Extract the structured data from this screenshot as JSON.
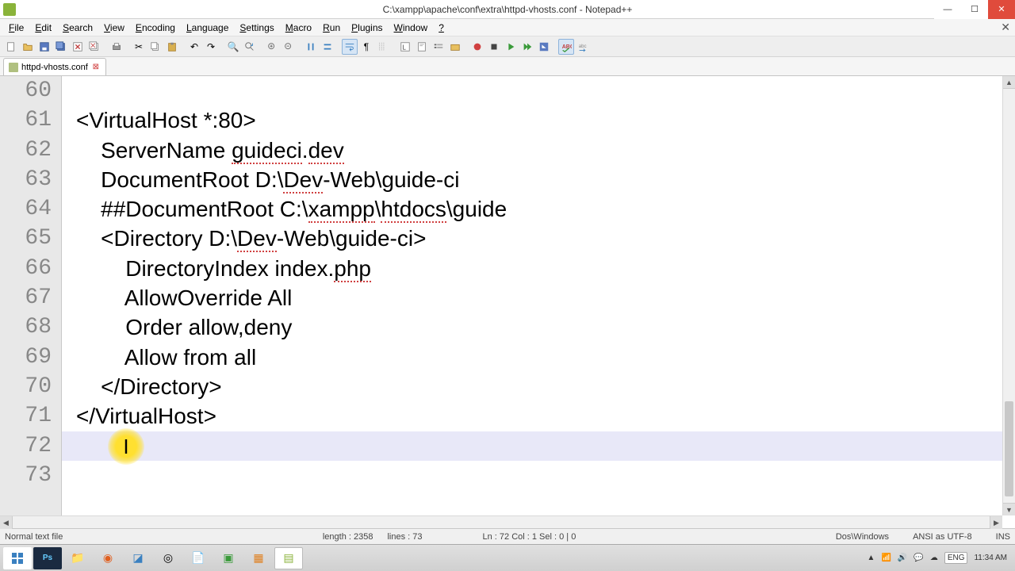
{
  "title": "C:\\xampp\\apache\\conf\\extra\\httpd-vhosts.conf - Notepad++",
  "menus": [
    "File",
    "Edit",
    "Search",
    "View",
    "Encoding",
    "Language",
    "Settings",
    "Macro",
    "Run",
    "Plugins",
    "Window",
    "?"
  ],
  "tab": {
    "label": "httpd-vhosts.conf"
  },
  "gutter_start": 60,
  "lines": [
    "",
    "<VirtualHost *:80>",
    "    ServerName guideci.dev",
    "    DocumentRoot D:\\Dev-Web\\guide-ci",
    "    ##DocumentRoot C:\\xampp\\htdocs\\guide",
    "    <Directory D:\\Dev-Web\\guide-ci>",
    "        DirectoryIndex index.php",
    "        AllowOverride All",
    "        Order allow,deny",
    "        Allow from all",
    "    </Directory>",
    "</VirtualHost>",
    "",
    ""
  ],
  "current_line_index": 12,
  "underline_spans": {
    "2": [
      [
        "guideci",
        0
      ],
      [
        "dev",
        0
      ]
    ],
    "3": [
      [
        "Dev",
        0
      ],
      [
        "ci",
        1
      ]
    ],
    "4": [
      [
        "xampp",
        0
      ],
      [
        "htdocs",
        0
      ]
    ],
    "5": [
      [
        "Dev",
        0
      ],
      [
        "ci",
        1
      ]
    ],
    "6": [
      [
        "php",
        0
      ]
    ]
  },
  "status": {
    "left": "Normal text file",
    "length": "length : 2358",
    "lines": "lines : 73",
    "pos": "Ln : 72    Col : 1    Sel : 0 | 0",
    "eol": "Dos\\Windows",
    "enc": "ANSI as UTF-8",
    "ins": "INS"
  },
  "tray": {
    "lang": "ENG",
    "time": "11:34 AM",
    "date": ""
  },
  "highlight_char": "I",
  "colors": {
    "gutter_bg": "#e8e8e8",
    "current_line": "#e8e8f8",
    "spell": "#d04040"
  }
}
